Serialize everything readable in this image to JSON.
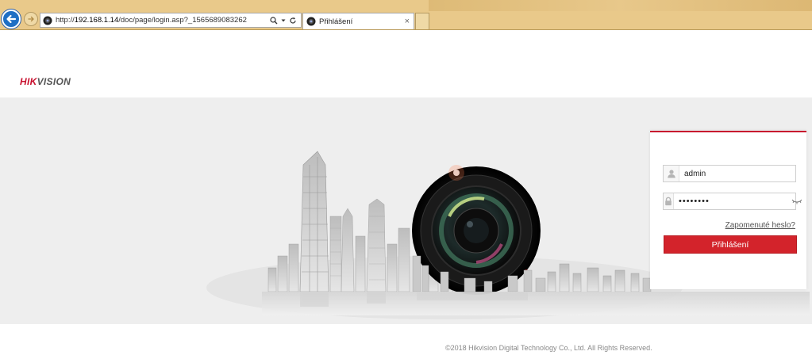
{
  "browser": {
    "url_prefix": "http://",
    "url_host": "192.168.1.14",
    "url_path": "/doc/page/login.asp?_1565689083262",
    "tab_title": "Přihlášení",
    "tab_close": "×"
  },
  "header": {
    "logo_part1": "HIK",
    "logo_part2": "VISION"
  },
  "login": {
    "username_value": "admin",
    "password_value": "••••••••",
    "forgot_label": "Zapomenuté heslo?",
    "login_button_label": "Přihlášení"
  },
  "footer": {
    "copyright": "©2018 Hikvision Digital Technology Co., Ltd. All Rights Reserved."
  },
  "colors": {
    "brand_red": "#c8102e",
    "button_red": "#d3232b",
    "browser_chrome": "#e9c98a",
    "back_button": "#1f6fc4"
  }
}
